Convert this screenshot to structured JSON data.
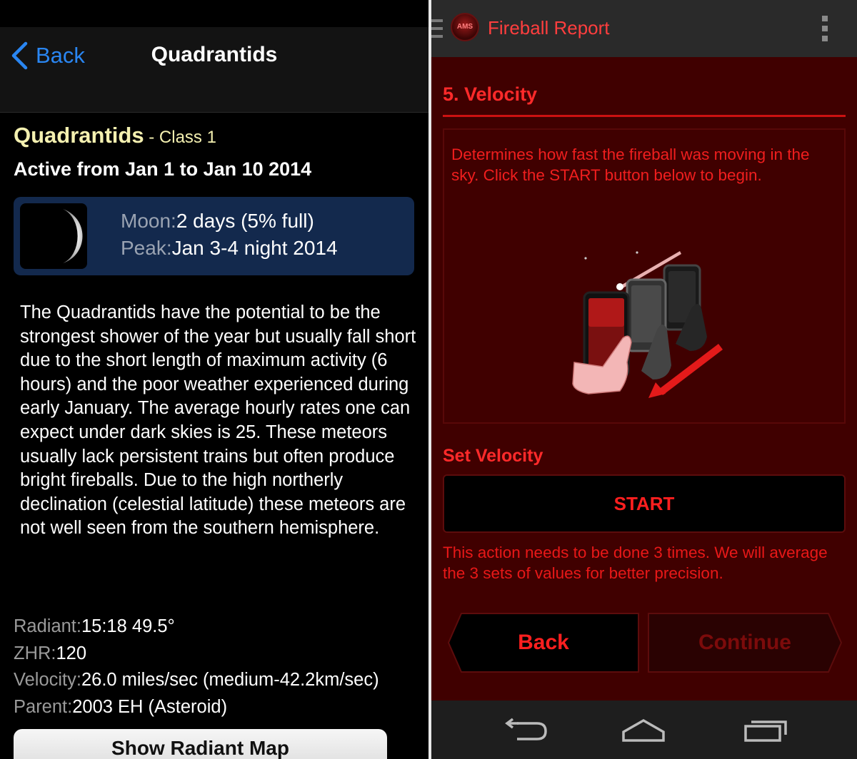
{
  "left": {
    "nav": {
      "back_label": "Back",
      "title": "Quadrantids"
    },
    "shower": {
      "name": "Quadrantids",
      "class_label": " - Class 1",
      "active": "Active from Jan 1 to Jan 10 2014"
    },
    "moon": {
      "moon_key": "Moon:",
      "moon_value": "2 days (5% full)",
      "peak_key": "Peak:",
      "peak_value": "Jan 3-4 night 2014"
    },
    "description": "The Quadrantids have the potential to be the strongest shower of the year but usually fall short due to the short length of maximum activity (6 hours) and the poor weather experienced during early January. The average hourly rates one can expect under dark skies is 25. These meteors usually lack persistent trains but often produce bright fireballs. Due to the high northerly declination (celestial latitude) these meteors are not well seen from the southern hemisphere.",
    "facts": [
      {
        "key": "Radiant:",
        "value": "15:18 49.5°"
      },
      {
        "key": "ZHR:",
        "value": "120"
      },
      {
        "key": "Velocity:",
        "value": "26.0 miles/sec (medium-42.2km/sec)"
      },
      {
        "key": "Parent:",
        "value": "2003 EH (Asteroid)"
      }
    ],
    "radiant_button": "Show Radiant Map"
  },
  "right": {
    "app": {
      "logo_text": "AMS",
      "title": "Fireball Report"
    },
    "section_title": "5. Velocity",
    "info_text": "Determines how fast the fireball was moving in the sky. Click the START button below to begin.",
    "set_velocity_label": "Set Velocity",
    "start_label": "START",
    "note": "This action needs to be done 3 times. We will average the 3 sets of values for better precision.",
    "back_label": "Back",
    "continue_label": "Continue"
  }
}
